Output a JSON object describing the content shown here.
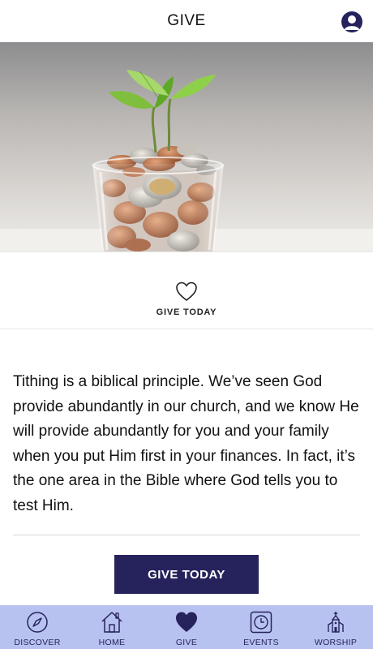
{
  "header": {
    "title": "GIVE",
    "profile_icon": "user-icon"
  },
  "hero": {
    "image": "plant-sprouting-from-glass-of-coins"
  },
  "give_section": {
    "icon": "heart-outline-icon",
    "label": "GIVE TODAY"
  },
  "content": {
    "body": "Tithing is a biblical principle. We’ve seen God provide abundantly in our church, and we know He will provide abundantly for you and your family when you put Him first in your finances. In fact, it’s the one area in the Bible where God tells you to test Him."
  },
  "cta": {
    "label": "GIVE TODAY"
  },
  "tabbar": {
    "items": [
      {
        "label": "DISCOVER",
        "icon": "compass-icon"
      },
      {
        "label": "HOME",
        "icon": "home-icon"
      },
      {
        "label": "GIVE",
        "icon": "heart-icon",
        "active": true
      },
      {
        "label": "EVENTS",
        "icon": "clock-icon"
      },
      {
        "label": "WORSHIP",
        "icon": "church-icon"
      }
    ]
  },
  "colors": {
    "brand": "#26235c",
    "tabbar_bg": "#b8c2f0"
  }
}
